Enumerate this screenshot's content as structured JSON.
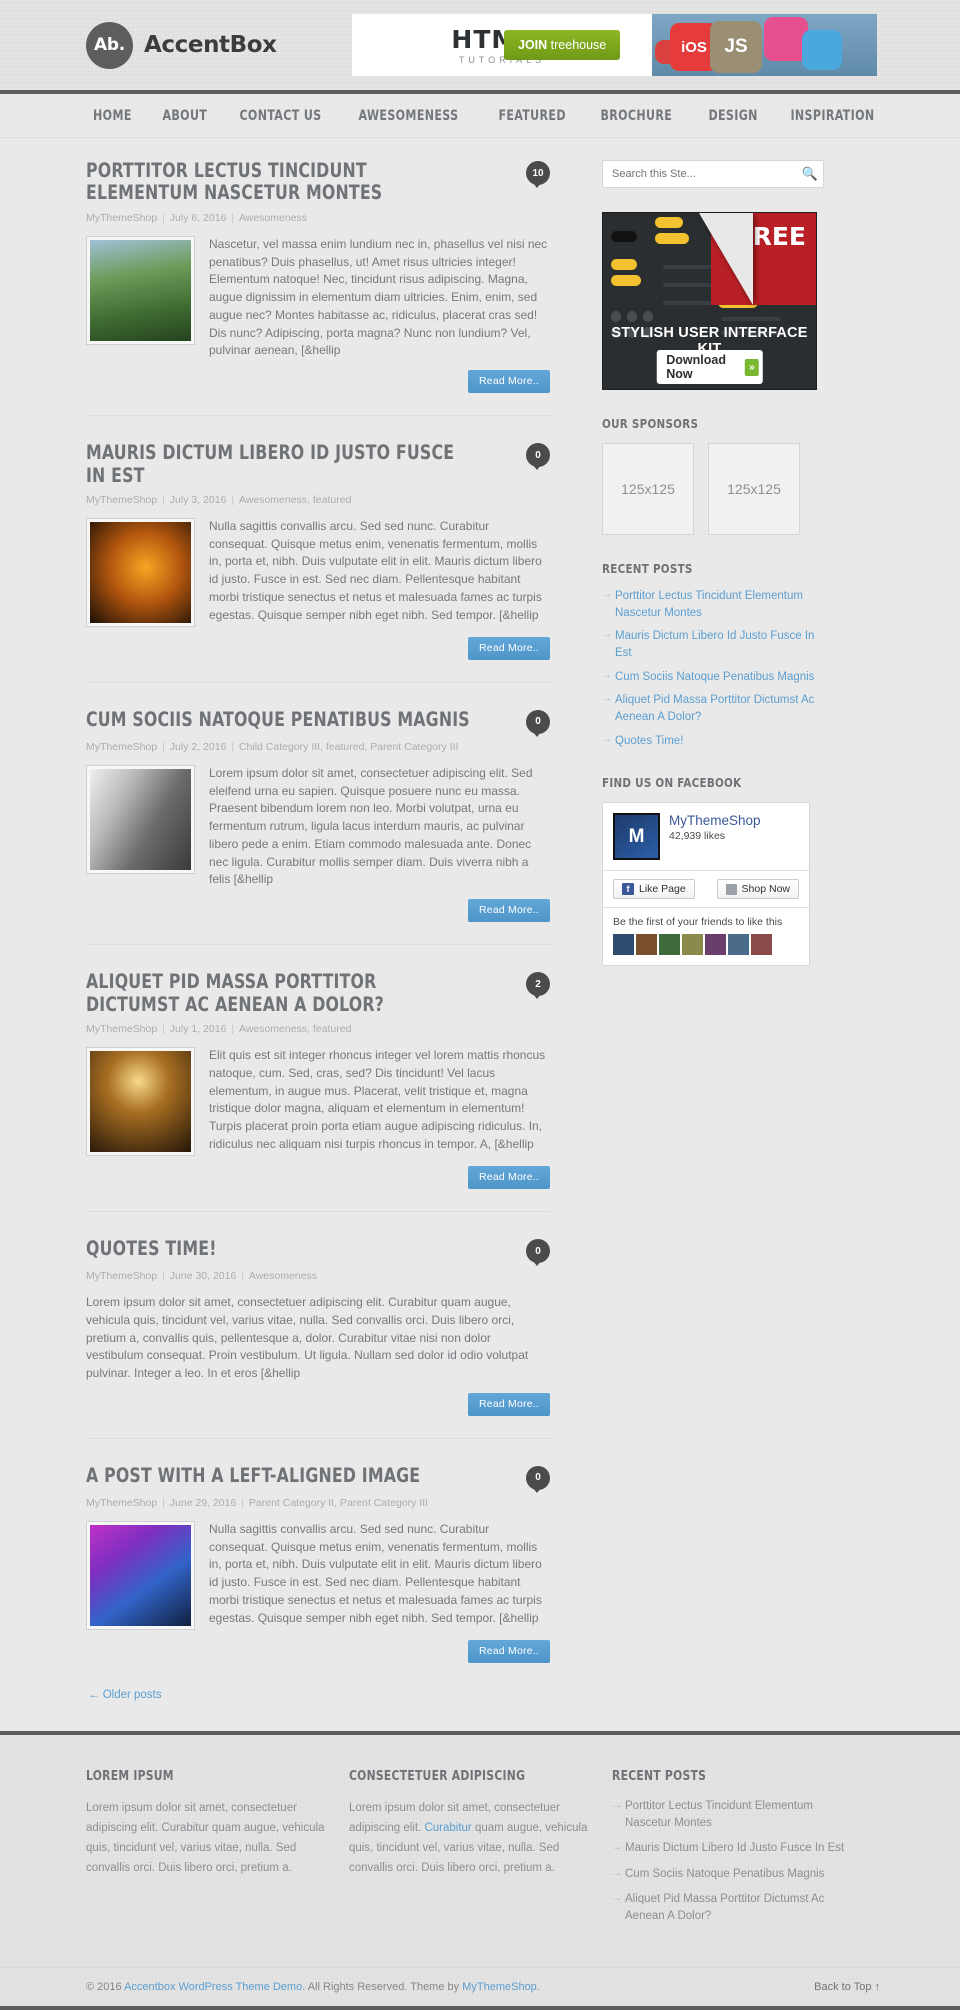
{
  "site": {
    "logo_badge": "Ab.",
    "logo_text": "AccentBox"
  },
  "ad_header": {
    "title": "HTML5",
    "subtitle": "TUTORIALS",
    "cta_prefix": "JOIN ",
    "cta_brand": "treehouse",
    "tile_ios": "iOS",
    "tile_js": "JS"
  },
  "nav": {
    "items": [
      {
        "label": "Home"
      },
      {
        "label": "About"
      },
      {
        "label": "Contact Us"
      },
      {
        "label": "Awesomeness"
      },
      {
        "label": "Featured"
      },
      {
        "label": "Brochure"
      },
      {
        "label": "Design"
      },
      {
        "label": "Inspiration"
      }
    ]
  },
  "posts": [
    {
      "title": "Porttitor Lectus Tincidunt Elementum Nascetur Montes",
      "comments": "10",
      "author": "MyThemeShop",
      "date": "July 6, 2016",
      "categories": "Awesomeness",
      "thumb": "img-river",
      "has_thumb": true,
      "excerpt": "Nascetur, vel massa enim lundium nec in, phasellus vel nisi nec penatibus? Duis phasellus, ut! Amet risus ultricies integer! Elementum natoque! Nec, tincidunt risus adipiscing. Magna, augue dignissim in elementum diam ultricies. Enim, enim, sed augue nec? Montes habitasse ac, ridiculus, placerat cras sed! Dis nunc? Adipiscing, porta magna? Nunc non lundium? Vel, pulvinar aenean, [&hellip",
      "read_more": "Read More.."
    },
    {
      "title": "Mauris Dictum Libero Id Justo Fusce In Est",
      "comments": "0",
      "author": "MyThemeShop",
      "date": "July 3, 2016",
      "categories": "Awesomeness, featured",
      "thumb": "img-pen",
      "has_thumb": true,
      "excerpt": "Nulla sagittis convallis arcu. Sed sed nunc. Curabitur consequat. Quisque metus enim, venenatis fermentum, mollis in, porta et, nibh. Duis vulputate elit in elit. Mauris dictum libero id justo. Fusce in est. Sed nec diam. Pellentesque habitant morbi tristique senectus et netus et malesuada fames ac turpis egestas. Quisque semper nibh eget nibh. Sed tempor. [&hellip",
      "read_more": "Read More.."
    },
    {
      "title": "Cum Sociis Natoque Penatibus Magnis",
      "comments": "0",
      "author": "MyThemeShop",
      "date": "July 2, 2016",
      "categories": "Child Category III, featured, Parent Category III",
      "thumb": "img-steps",
      "has_thumb": true,
      "excerpt": "Lorem ipsum dolor sit amet, consectetuer adipiscing elit. Sed eleifend urna eu sapien. Quisque posuere nunc eu massa. Praesent bibendum lorem non leo. Morbi volutpat, urna eu fermentum rutrum, ligula lacus interdum mauris, ac pulvinar libero pede a enim. Etiam commodo malesuada ante. Donec nec ligula. Curabitur mollis semper diam. Duis viverra nibh a felis [&hellip",
      "read_more": "Read More.."
    },
    {
      "title": "Aliquet Pid Massa Porttitor Dictumst Ac Aenean A Dolor?",
      "comments": "2",
      "author": "MyThemeShop",
      "date": "July 1, 2016",
      "categories": "Awesomeness, featured",
      "thumb": "img-stage",
      "has_thumb": true,
      "excerpt": "Elit quis est sit integer rhoncus integer vel lorem mattis rhoncus natoque, cum. Sed, cras, sed? Dis tincidunt! Vel lacus elementum, in augue mus. Placerat, velit tristique et, magna tristique dolor magna, aliquam et elementum in elementum! Turpis placerat proin porta etiam augue adipiscing ridiculus. In, ridiculus nec aliquam nisi turpis rhoncus in tempor. A, [&hellip",
      "read_more": "Read More.."
    },
    {
      "title": "Quotes Time!",
      "comments": "0",
      "author": "MyThemeShop",
      "date": "June 30, 2016",
      "categories": "Awesomeness",
      "thumb": "",
      "has_thumb": false,
      "excerpt": "Lorem ipsum dolor sit amet, consectetuer adipiscing elit. Curabitur quam augue, vehicula quis, tincidunt vel, varius vitae, nulla. Sed convallis orci. Duis libero orci, pretium a, convallis quis, pellentesque a, dolor. Curabitur vitae nisi non dolor vestibulum consequat. Proin vestibulum. Ut ligula. Nullam sed dolor id odio volutpat pulvinar. Integer a leo. In et eros [&hellip",
      "read_more": "Read More.."
    },
    {
      "title": "A Post With A Left-Aligned Image",
      "comments": "0",
      "author": "MyThemeShop",
      "date": "June 29, 2016",
      "categories": "Parent Category II, Parent Category III",
      "thumb": "img-dance",
      "has_thumb": true,
      "excerpt": "Nulla sagittis convallis arcu. Sed sed nunc. Curabitur consequat. Quisque metus enim, venenatis fermentum, mollis in, porta et, nibh. Duis vulputate elit in elit. Mauris dictum libero id justo. Fusce in est. Sed nec diam. Pellentesque habitant morbi tristique senectus et netus et malesuada fames ac turpis egestas. Quisque semper nibh eget nibh. Sed tempor. [&hellip",
      "read_more": "Read More.."
    }
  ],
  "pagination": {
    "older": "← Older posts"
  },
  "sidebar": {
    "search": {
      "placeholder": "Search this Ste...",
      "value": ""
    },
    "ad": {
      "free_label": "FREE",
      "caption": "STYLISH USER INTERFACE KIT",
      "download_label": "Download Now",
      "chevron": "»"
    },
    "sponsors": {
      "title": "Our Sponsors",
      "boxes": [
        "125x125",
        "125x125"
      ]
    },
    "recent": {
      "title": "Recent Posts",
      "items": [
        "Porttitor Lectus Tincidunt Elementum Nascetur Montes",
        "Mauris Dictum Libero Id Justo Fusce In Est",
        "Cum Sociis Natoque Penatibus Magnis",
        "Aliquet Pid Massa Porttitor Dictumst Ac Aenean A Dolor?",
        "Quotes Time!"
      ]
    },
    "facebook": {
      "title": "Find Us On Facebook",
      "page_name": "MyThemeShop",
      "likes": "42,939 likes",
      "avatar_letter": "M",
      "like_button": "Like Page",
      "shop_button": "Shop Now",
      "friends_text": "Be the first of your friends to like this"
    }
  },
  "footer": {
    "col1": {
      "title": "Lorem Ipsum",
      "text": "Lorem ipsum dolor sit amet, consectetuer adipiscing elit. Curabitur quam augue, vehicula quis, tincidunt vel, varius vitae, nulla. Sed convallis orci. Duis libero orci, pretium a."
    },
    "col2": {
      "title": "Consectetuer Adipiscing",
      "text_before": "Lorem ipsum dolor sit amet, consectetuer adipiscing elit. ",
      "link": "Curabitur",
      "text_after": " quam augue, vehicula quis, tincidunt vel, varius vitae, nulla. Sed convallis orci. Duis libero orci, pretium a."
    },
    "col3": {
      "title": "Recent Posts",
      "items": [
        "Porttitor Lectus Tincidunt Elementum Nascetur Montes",
        "Mauris Dictum Libero Id Justo Fusce In Est",
        "Cum Sociis Natoque Penatibus Magnis",
        "Aliquet Pid Massa Porttitor Dictumst Ac Aenean A Dolor?"
      ]
    },
    "copyright": {
      "prefix": "© 2016 ",
      "link1": "Accentbox WordPress Theme Demo",
      "middle": ". All Rights Reserved. Theme by ",
      "link2": "MyThemeShop",
      "suffix": ".",
      "back_to_top": "Back to Top ↑"
    }
  }
}
